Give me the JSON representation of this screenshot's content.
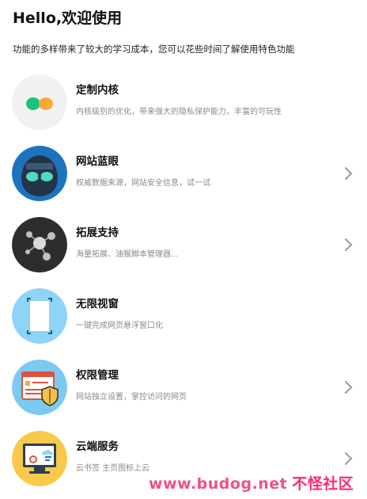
{
  "header": {
    "title": "Hello,欢迎使用",
    "subtitle": "功能的多样带来了较大的学习成本，您可以花些时间了解使用特色功能"
  },
  "features": [
    {
      "name": "定制内核",
      "desc": "内核级别的优化，带来强大的隐私保护能力，丰富的可玩性",
      "icon": "kernel-icon",
      "has_arrow": false
    },
    {
      "name": "网站蓝眼",
      "desc": "权威数据来源，网站安全信息，试一试",
      "icon": "blue-eye-icon",
      "has_arrow": true
    },
    {
      "name": "拓展支持",
      "desc": "海量拓展、油猴脚本管理器...",
      "icon": "extension-icon",
      "has_arrow": true
    },
    {
      "name": "无限视窗",
      "desc": "一键完成网页悬浮窗口化",
      "icon": "floating-window-icon",
      "has_arrow": false
    },
    {
      "name": "权限管理",
      "desc": "网站独立设置，掌控访问的网页",
      "icon": "permission-icon",
      "has_arrow": true
    },
    {
      "name": "云端服务",
      "desc": "云书签 主页图标上云",
      "icon": "cloud-service-icon",
      "has_arrow": true
    }
  ],
  "watermark": {
    "url": "www.budog.net",
    "cn": "不怪社区"
  },
  "colors": {
    "blue": "#1e73be",
    "dark": "#2d2d2d",
    "light_blue": "#8fd3f7",
    "sky": "#7ccaf0",
    "yellow": "#f8c94a",
    "green": "#18c47a",
    "orange": "#f7a93a"
  }
}
